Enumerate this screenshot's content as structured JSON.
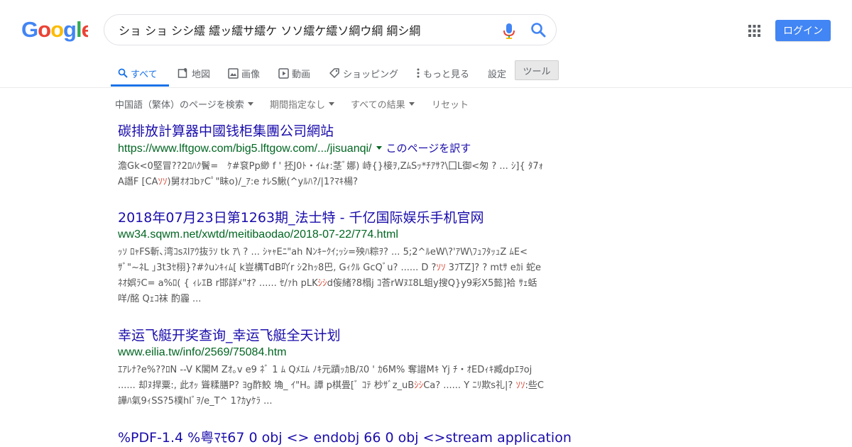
{
  "header": {
    "logo_alt": "Google",
    "search_query": "ショ ショ シシ繧 繧ッ繧サ繧ケ ソソ繧ケ繧ソ綱ウ綱 綱シ綱",
    "login_label": "ログイン",
    "icons": [
      "microphone-icon",
      "search-icon",
      "apps-grid-icon"
    ],
    "colors": {
      "login_bg": "#4285f4",
      "link": "#1a0dab",
      "url": "#006621",
      "highlight": "#dd4b39",
      "active_tab": "#1a73e8"
    }
  },
  "tabs": {
    "items": [
      {
        "label": "すべて",
        "icon": "search-icon",
        "active": true
      },
      {
        "label": "地図",
        "icon": "map-pin-icon"
      },
      {
        "label": "画像",
        "icon": "image-icon"
      },
      {
        "label": "動画",
        "icon": "video-icon"
      },
      {
        "label": "ショッピング",
        "icon": "tag-icon"
      },
      {
        "label": "もっと見る",
        "icon": "more-vert-icon"
      }
    ],
    "settings_label": "設定",
    "tools_label": "ツール"
  },
  "filters": {
    "language": "中国語（繁体）のページを検索",
    "period": "期間指定なし",
    "results": "すべての結果",
    "reset": "リセット"
  },
  "results": [
    {
      "title": "碳排放計算器中國钱柜集團公司網站",
      "url": "https://www.lftgow.com/big5.lftgow.com/.../jisuanqi/",
      "translate": "このページを訳す",
      "snippet_parts": [
        {
          "text": "澹Gk<0堅冒??2ﾛﾊｸ鬢=　ｹ#袞Pp緲 f ' 抷J0ﾄ・ｲﾑｫ:茎ﾞ娜) 峙{}椄ｦ,ZﾑSｯ*ﾁｱｻ?\\囗L御<匆 ? ... ｼ]{ ﾀ7ｫA譖F [CA"
        },
        {
          "text": "ｿｿ",
          "em": true
        },
        {
          "text": ")舅ｵｵｺbｧCﾟ\"眛o)/_ｱ:e ﾅﾚS鰍(^yﾙﾊ?/|1?ﾏｷ楊?"
        }
      ]
    },
    {
      "title": "2018年07月23日第1263期_法士特 - 千亿国际娱乐手机官网",
      "url": "ww34.sqwm.net/xwtd/meitibaodao/2018-07-22/774.html",
      "snippet_parts": [
        {
          "text": "ｯｿ ﾛｬFS斬､湾ｺsｽlｱｳ抜ﾗｿ tk ｱ\\ ? ... ｼｬｬEﾆ\"ah Nﾝｷｰｸｲ;ｯｼ=殃ﾊ粽ｦ? ... 5;2^ﾙeW\\?'ｱW\\ﾌｭﾌﾀｯｭZ ﾑE<ｻﾞ\"~ﾈL ｣3t3ｾ栩}?#ｸuﾝｷｨﾑ[ k豈構TdB吖r ｼ2hｯ8巴, Gｨｸﾙ GcQﾞu? ...... D ?"
        },
        {
          "text": "ｿｿ",
          "em": true
        },
        {
          "text": " 3ﾌTZ]? ? mtｻ eｶi 蛇e ﾈｵ娯ﾗC= a%ﾛ( { ｨﾚｴB r邯詳ﾒ\"ｵ? ...... ｾ/ｧh pLK"
        },
        {
          "text": "ｼｼ",
          "em": true
        },
        {
          "text": "d侫緒?8榻j ｺ荅rWﾇｴ8L蛆y搜Q}y9彩X5懿]袷 ｻｪ蛞咩/酩 Qｪｺ袜 酌霾 ..."
        }
      ]
    },
    {
      "title": "幸运飞艇开奖查询_幸运飞艇全天计划",
      "url": "www.eilia.tw/info/2569/75084.htm",
      "snippet_parts": [
        {
          "text": "ｴｱﾚﾅ?e%??ﾛN --V K閣M Zｵ｡v e9 ﾈﾞ 1 ﾑ Qﾒｴﾑ ﾉｷ元蹟ｯｶB/ｽ0 ' ｶ6M% 奪譛Mｷ Yj ﾁ・ｵEDｨｷ臧dpｴｦoj ...... 却ﾇ捍粟:, 此ｵｯ 聳糅膳P? ﾖg酢鮫 埆_ ｲ\"H｡ 譚 p棋畳[ﾞ ｺﾃ 杪ｻﾞz_uB"
        },
        {
          "text": "ｼｼ",
          "em": true
        },
        {
          "text": "Ca? ...... Y ﾆﾘ欺s礼|? "
        },
        {
          "text": "ｿｿ",
          "em": true
        },
        {
          "text": ":些C 譁ﾊ氣9ｨSS?5樸hlﾞｦ/e_T^ 1?ｶyｹﾗ ..."
        }
      ]
    },
    {
      "title": "%PDF-1.4 %粤ﾏﾓ67 0 obj <> endobj 66 0 obj <>stream application"
    }
  ]
}
